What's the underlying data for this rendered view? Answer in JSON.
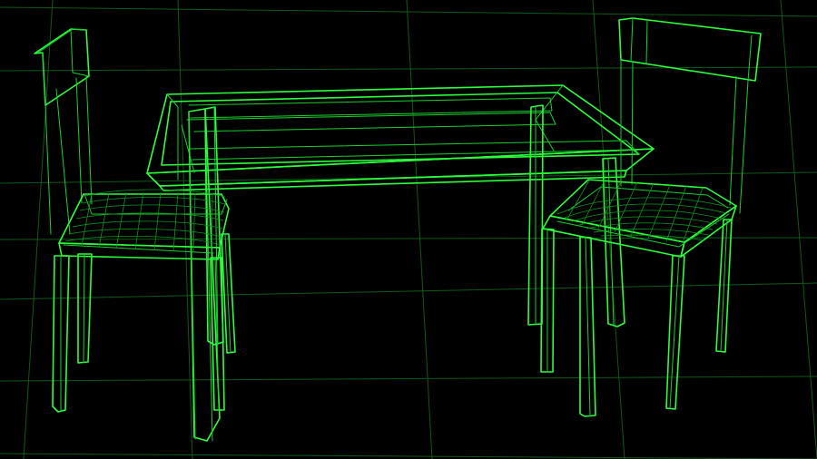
{
  "scene": {
    "view_mode": "wireframe",
    "background_color": "#000000",
    "grid_color": "#0f5f18",
    "wire_color": "#2bff3b",
    "objects": [
      "table",
      "chair-left",
      "chair-right"
    ]
  }
}
